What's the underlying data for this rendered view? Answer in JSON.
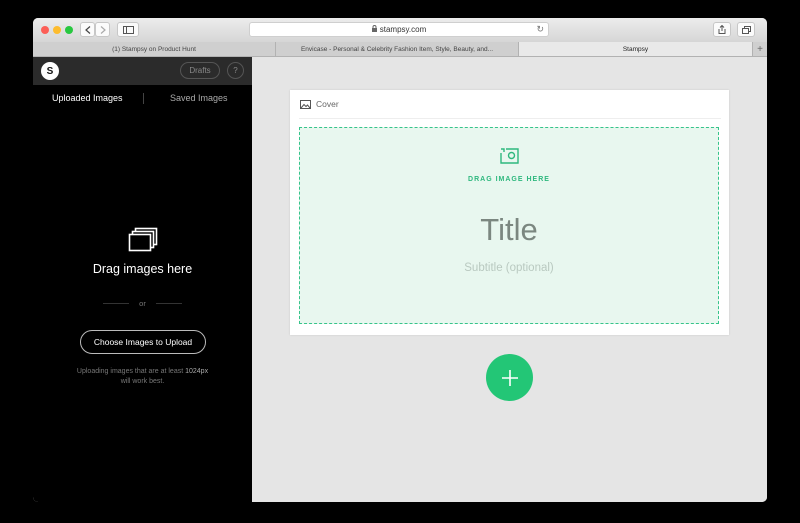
{
  "browser": {
    "address": "stampsy.com",
    "tabs": [
      {
        "label": "(1) Stampsy on Product Hunt"
      },
      {
        "label": "Envicase - Personal & Celebrity Fashion Item, Style, Beauty, and..."
      },
      {
        "label": "Stampsy"
      }
    ]
  },
  "sidebar": {
    "logo": "S",
    "drafts_label": "Drafts",
    "help_label": "?",
    "tabs": [
      {
        "label": "Uploaded Images"
      },
      {
        "label": "Saved Images"
      }
    ],
    "drop_title": "Drag images here",
    "or_label": "or",
    "choose_button": "Choose Images to Upload",
    "hint_line1": "Uploading images that are at least",
    "hint_size": "1024px",
    "hint_line2": "will work best."
  },
  "editor": {
    "cover_label": "Cover",
    "drag_image_label": "DRAG IMAGE HERE",
    "title_placeholder": "Title",
    "subtitle_placeholder": "Subtitle (optional)"
  },
  "colors": {
    "accent": "#23c676",
    "drop_zone_bg": "#e8f7ef"
  }
}
